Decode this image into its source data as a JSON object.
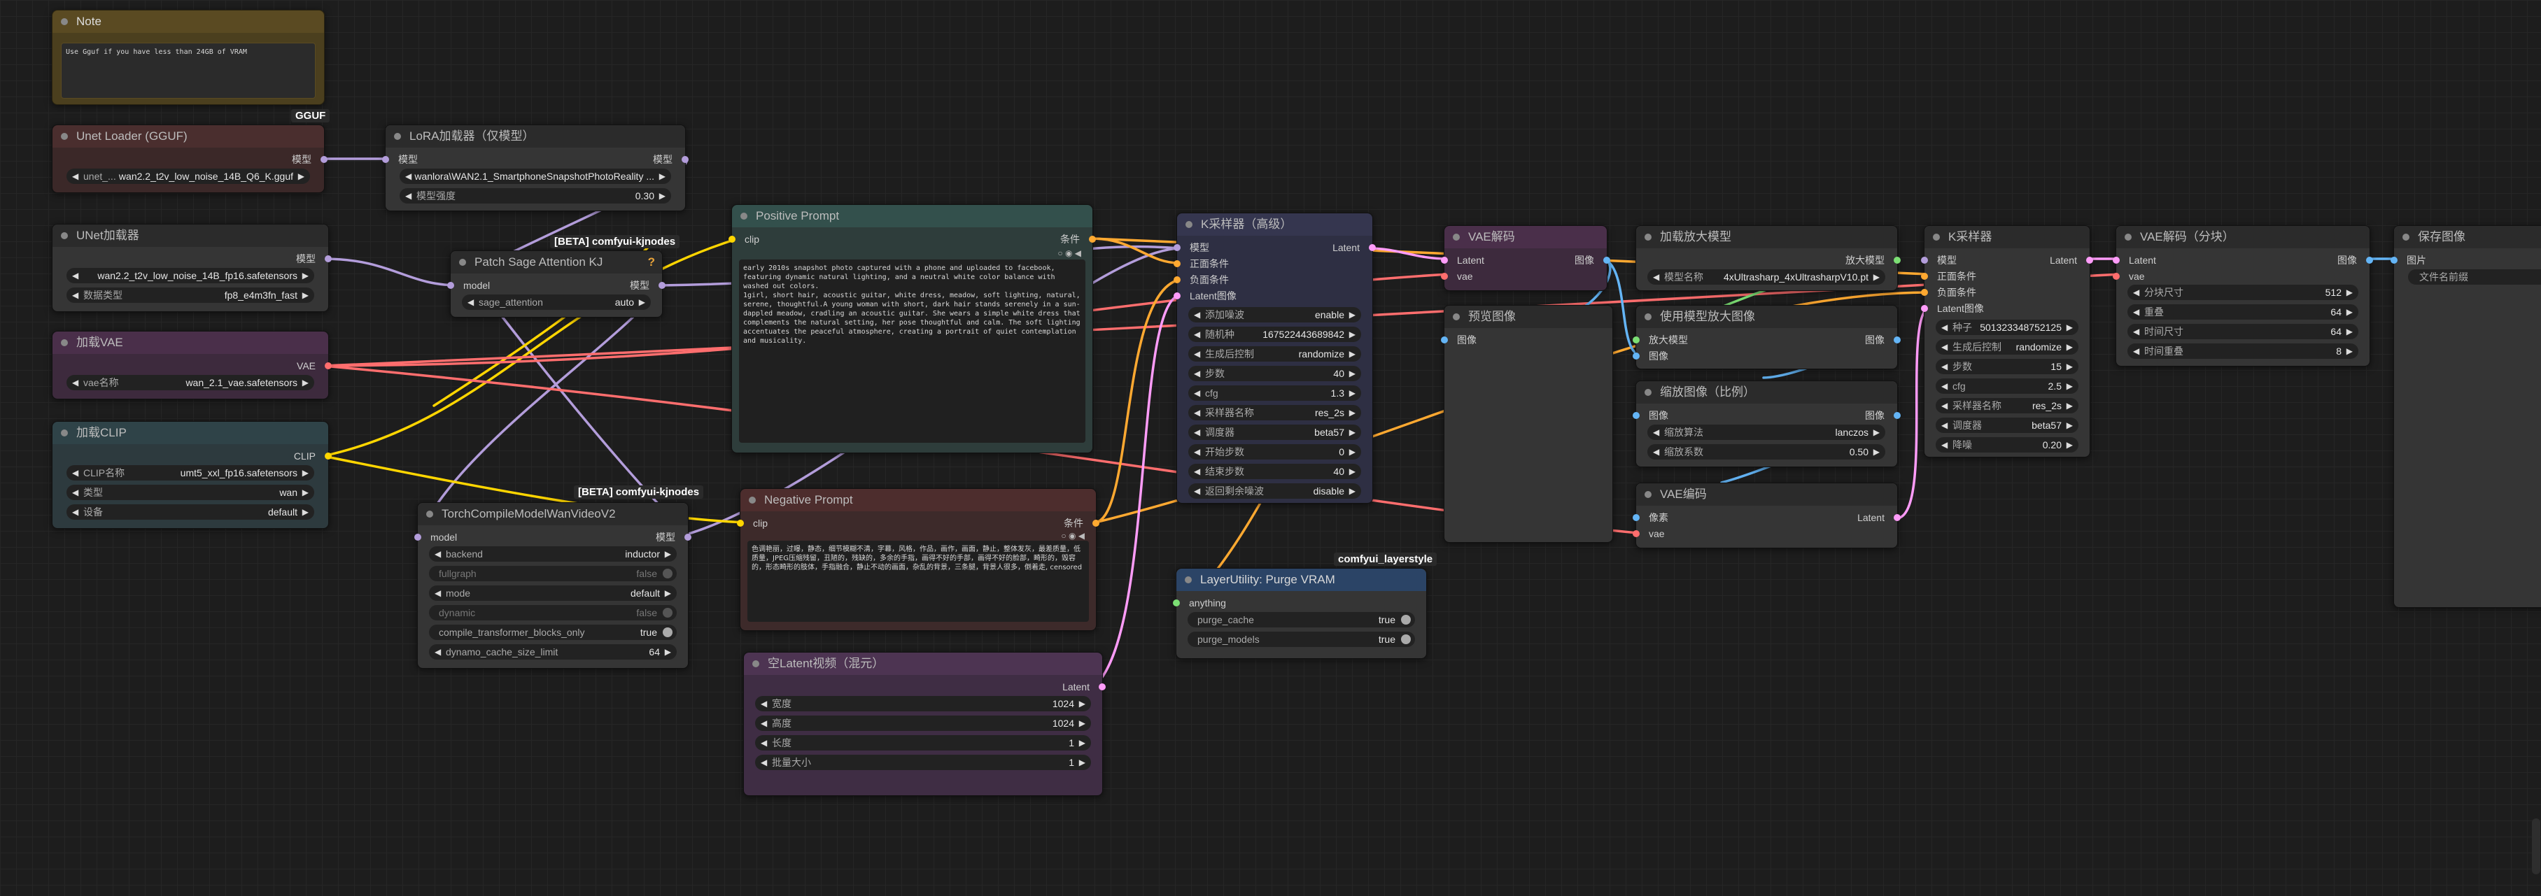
{
  "colors": {
    "model": "#b39ddb",
    "clip": "#ffd600",
    "vae": "#ff6e6e",
    "latent": "#ff9cf9",
    "conditioning": "#ffa931",
    "image": "#64b5f6",
    "upscale": "#7cdf74"
  },
  "note": {
    "title": "Note",
    "text": "Use Gguf if you have less than 24GB of VRAM",
    "badge": "GGUF"
  },
  "unet_gguf": {
    "title": "Unet Loader (GGUF)",
    "out": "模型",
    "unet_label": "unet_...",
    "unet_value": "wan2.2_t2v_low_noise_14B_Q6_K.gguf"
  },
  "lora": {
    "title": "LoRA加载器（仅模型）",
    "in_model": "模型",
    "out_model": "模型",
    "lora_value": "wanlora\\WAN2.1_SmartphoneSnapshotPhotoReality ...",
    "strength_label": "模型强度",
    "strength_value": "0.30"
  },
  "unet_loader": {
    "title": "UNet加载器",
    "out": "模型",
    "name_value": "wan2.2_t2v_low_noise_14B_fp16.safetensors",
    "dtype_label": "数据类型",
    "dtype_value": "fp8_e4m3fn_fast"
  },
  "patch_sage": {
    "badge": "[BETA] comfyui-kjnodes",
    "title": "Patch Sage Attention KJ",
    "in_model": "model",
    "out_model": "模型",
    "sage_label": "sage_attention",
    "sage_value": "auto"
  },
  "vae_loader": {
    "title": "加载VAE",
    "out": "VAE",
    "name_label": "vae名称",
    "name_value": "wan_2.1_vae.safetensors"
  },
  "clip_loader": {
    "title": "加载CLIP",
    "out": "CLIP",
    "name_label": "CLIP名称",
    "name_value": "umt5_xxl_fp16.safetensors",
    "type_label": "类型",
    "type_value": "wan",
    "device_label": "设备",
    "device_value": "default"
  },
  "torch_compile": {
    "badge": "[BETA] comfyui-kjnodes",
    "title": "TorchCompileModelWanVideoV2",
    "in_model": "model",
    "out_model": "模型",
    "widgets": [
      {
        "label": "backend",
        "value": "inductor"
      },
      {
        "label": "fullgraph",
        "value": "false"
      },
      {
        "label": "mode",
        "value": "default"
      },
      {
        "label": "dynamic",
        "value": "false"
      },
      {
        "label": "compile_transformer_blocks_only",
        "value": "true"
      },
      {
        "label": "dynamo_cache_size_limit",
        "value": "64"
      }
    ]
  },
  "positive": {
    "title": "Positive Prompt",
    "in": "clip",
    "out": "条件",
    "text": "early 2010s snapshot photo captured with a phone and uploaded to facebook, featuring dynamic natural lighting, and a neutral white color balance with washed out colors.\n1girl, short hair, acoustic guitar, white dress, meadow, soft lighting, natural, serene, thoughtful.A young woman with short, dark hair stands serenely in a sun-dappled meadow, cradling an acoustic guitar. She wears a simple white dress that complements the natural setting, her pose thoughtful and calm. The soft lighting accentuates the peaceful atmosphere, creating a portrait of quiet contemplation and musicality."
  },
  "negative": {
    "title": "Negative Prompt",
    "in": "clip",
    "out": "条件",
    "text": "色调艳丽，过曝，静态，细节模糊不清，字幕，风格，作品，画作，画面，静止，整体发灰，最差质量，低质量，JPEG压缩残留，丑陋的，残缺的，多余的手指，画得不好的手部，画得不好的脸部，畸形的，毁容的，形态畸形的肢体，手指融合，静止不动的画面，杂乱的背景，三条腿，背景人很多，倒着走, censored"
  },
  "empty_latent": {
    "title": "空Latent视频（混元）",
    "out": "Latent",
    "widgets": [
      {
        "label": "宽度",
        "value": "1024"
      },
      {
        "label": "高度",
        "value": "1024"
      },
      {
        "label": "长度",
        "value": "1"
      },
      {
        "label": "批量大小",
        "value": "1"
      }
    ]
  },
  "ksampler_adv": {
    "title": "K采样器（高级）",
    "inputs": [
      "模型",
      "正面条件",
      "负面条件",
      "Latent图像"
    ],
    "out": "Latent",
    "widgets": [
      {
        "label": "添加噪波",
        "value": "enable"
      },
      {
        "label": "随机种",
        "value": "167522443689842"
      },
      {
        "label": "生成后控制",
        "value": "randomize"
      },
      {
        "label": "步数",
        "value": "40"
      },
      {
        "label": "cfg",
        "value": "1.3"
      },
      {
        "label": "采样器名称",
        "value": "res_2s"
      },
      {
        "label": "调度器",
        "value": "beta57"
      },
      {
        "label": "开始步数",
        "value": "0"
      },
      {
        "label": "结束步数",
        "value": "40"
      },
      {
        "label": "返回剩余噪波",
        "value": "disable"
      }
    ]
  },
  "purge_vram": {
    "badge": "comfyui_layerstyle",
    "title": "LayerUtility: Purge VRAM",
    "in": "anything",
    "cache_label": "purge_cache",
    "cache_value": "true",
    "models_label": "purge_models",
    "models_value": "true"
  },
  "vae_decode": {
    "title": "VAE解码",
    "in_latent": "Latent",
    "in_vae": "vae",
    "out": "图像"
  },
  "preview": {
    "title": "预览图像",
    "in": "图像"
  },
  "upscale_loader": {
    "title": "加载放大模型",
    "out": "放大模型",
    "name_label": "模型名称",
    "name_value": "4xUltrasharp_4xUltrasharpV10.pt"
  },
  "upscale_with_model": {
    "title": "使用模型放大图像",
    "in_model": "放大模型",
    "in_image": "图像",
    "out": "图像"
  },
  "scale_by": {
    "title": "缩放图像（比例）",
    "in": "图像",
    "out": "图像",
    "method_label": "缩放算法",
    "method_value": "lanczos",
    "factor_label": "缩放系数",
    "factor_value": "0.50"
  },
  "vae_encode": {
    "title": "VAE编码",
    "in_pixels": "像素",
    "in_vae": "vae",
    "out": "Latent"
  },
  "ksampler2": {
    "title": "K采样器",
    "inputs": [
      "模型",
      "正面条件",
      "负面条件",
      "Latent图像"
    ],
    "out": "Latent",
    "widgets": [
      {
        "label": "种子",
        "value": "501323348752125"
      },
      {
        "label": "生成后控制",
        "value": "randomize"
      },
      {
        "label": "步数",
        "value": "15"
      },
      {
        "label": "cfg",
        "value": "2.5"
      },
      {
        "label": "采样器名称",
        "value": "res_2s"
      },
      {
        "label": "调度器",
        "value": "beta57"
      },
      {
        "label": "降噪",
        "value": "0.20"
      }
    ]
  },
  "vae_decode_tiled": {
    "title": "VAE解码（分块）",
    "in_latent": "Latent",
    "in_vae": "vae",
    "out": "图像",
    "widgets": [
      {
        "label": "分块尺寸",
        "value": "512"
      },
      {
        "label": "重叠",
        "value": "64"
      },
      {
        "label": "时间尺寸",
        "value": "64"
      },
      {
        "label": "时间重叠",
        "value": "8"
      }
    ]
  },
  "save_image": {
    "title": "保存图像",
    "in": "图片",
    "prefix_value": "文件名前缀"
  }
}
